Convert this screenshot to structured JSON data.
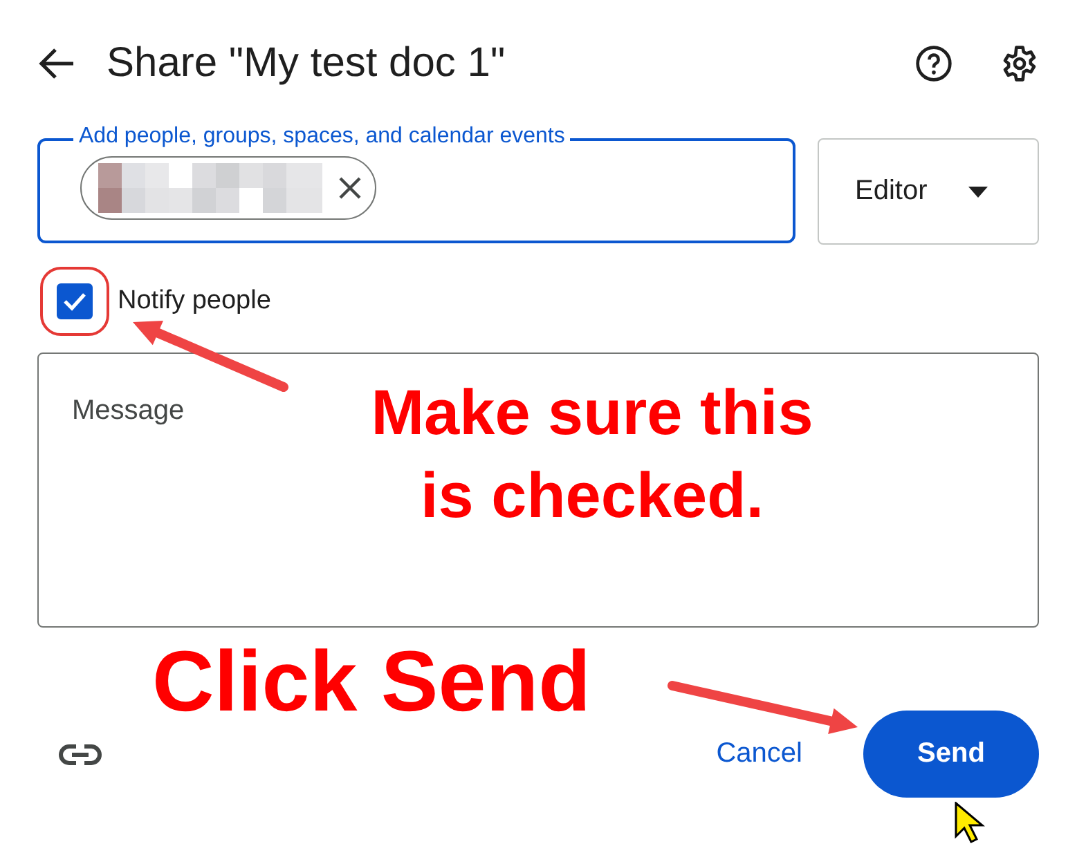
{
  "dialog": {
    "title": "Share \"My test doc 1\""
  },
  "people_field": {
    "label": "Add people, groups, spaces, and calendar events"
  },
  "role_dropdown": {
    "value": "Editor"
  },
  "notify": {
    "label": "Notify people",
    "checked": true
  },
  "message": {
    "placeholder": "Message"
  },
  "buttons": {
    "cancel": "Cancel",
    "send": "Send"
  },
  "annotations": [
    {
      "kind": "note",
      "text": "Make sure this\nis checked."
    },
    {
      "kind": "callout",
      "text": "Click Send"
    }
  ]
}
